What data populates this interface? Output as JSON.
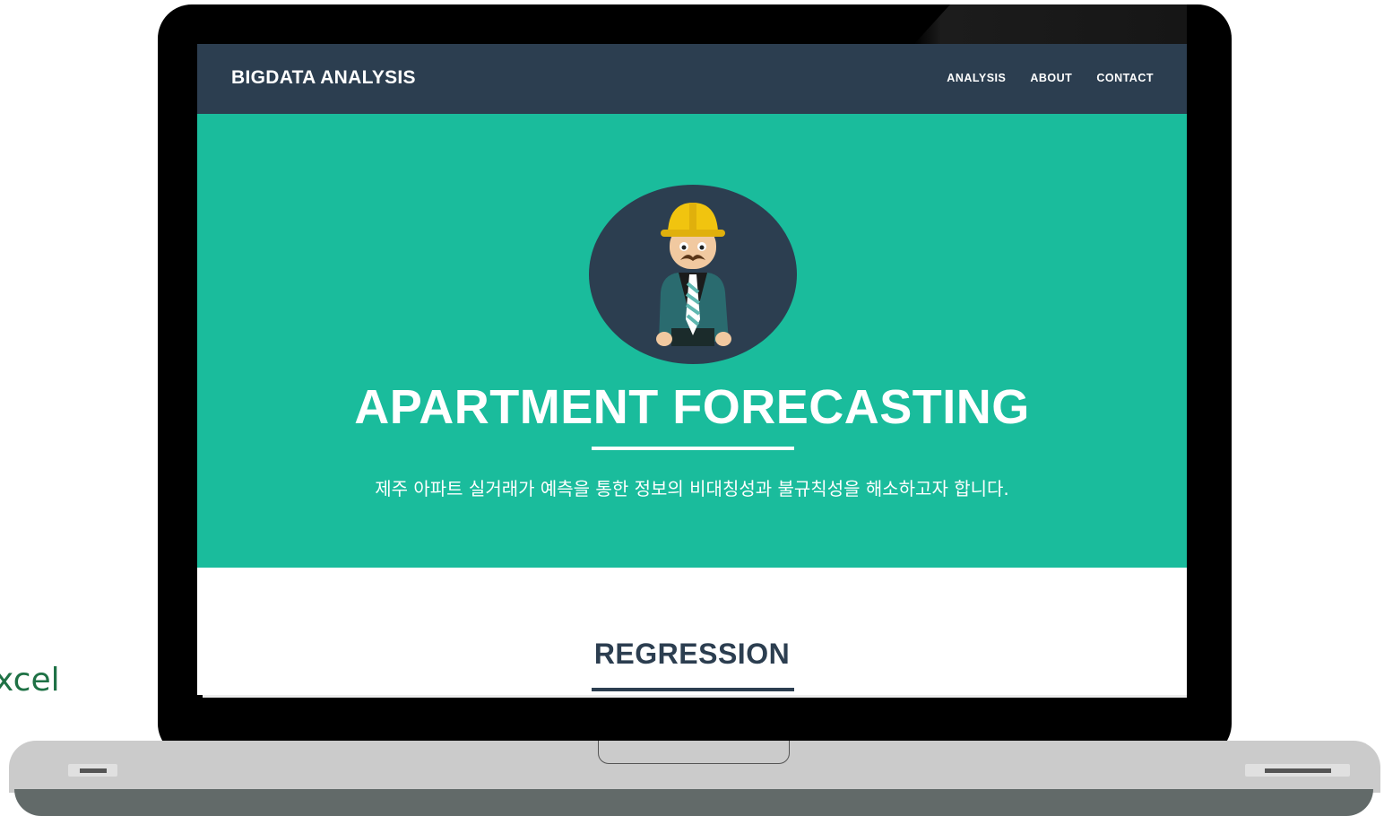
{
  "background": {
    "partial_text": "xcel"
  },
  "nav": {
    "brand": "BIGDATA ANALYSIS",
    "links": [
      "ANALYSIS",
      "ABOUT",
      "CONTACT"
    ]
  },
  "hero": {
    "avatar_icon": "construction-worker-avatar",
    "title": "APARTMENT FORECASTING",
    "subtitle": "제주 아파트 실거래가 예측을 통한 정보의 비대칭성과 불규칙성을 해소하고자 합니다."
  },
  "section": {
    "title": "REGRESSION"
  },
  "colors": {
    "nav_bg": "#2c3e50",
    "hero_bg": "#1abc9c",
    "text_light": "#ffffff",
    "text_dark": "#2c3e50",
    "excel_green": "#1e7145"
  }
}
